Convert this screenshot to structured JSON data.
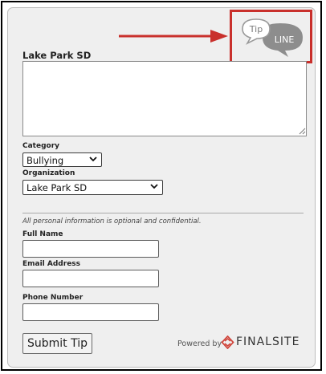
{
  "form": {
    "title": "Lake Park SD",
    "category_label": "Category",
    "category_value": "Bullying",
    "organization_label": "Organization",
    "organization_value": "Lake Park SD",
    "privacy_note": "All personal information is optional and confidential.",
    "full_name_label": "Full Name",
    "email_label": "Email Address",
    "phone_label": "Phone Number",
    "submit_label": "Submit Tip"
  },
  "logo": {
    "tip": "Tip",
    "line": "LINE"
  },
  "footer": {
    "powered_by": "Powered by",
    "brand": "FINALSITE"
  },
  "colors": {
    "highlight": "#c9302c",
    "logo_gray": "#8d8d8d"
  }
}
